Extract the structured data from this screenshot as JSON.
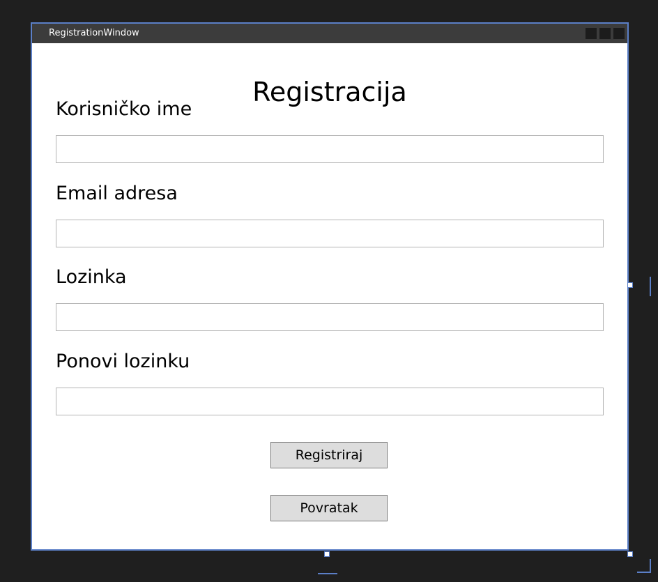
{
  "window": {
    "title": "RegistrationWindow"
  },
  "form": {
    "title": "Registracija",
    "fields": [
      {
        "label": "Korisničko ime",
        "value": ""
      },
      {
        "label": "Email adresa",
        "value": ""
      },
      {
        "label": "Lozinka",
        "value": ""
      },
      {
        "label": "Ponovi lozinku",
        "value": ""
      }
    ],
    "register_button": "Registriraj",
    "back_button": "Povratak"
  },
  "colors": {
    "background": "#1f1f1f",
    "window_border": "#5b7fc7",
    "titlebar": "#3c3c3c",
    "button_bg": "#dddddd"
  }
}
